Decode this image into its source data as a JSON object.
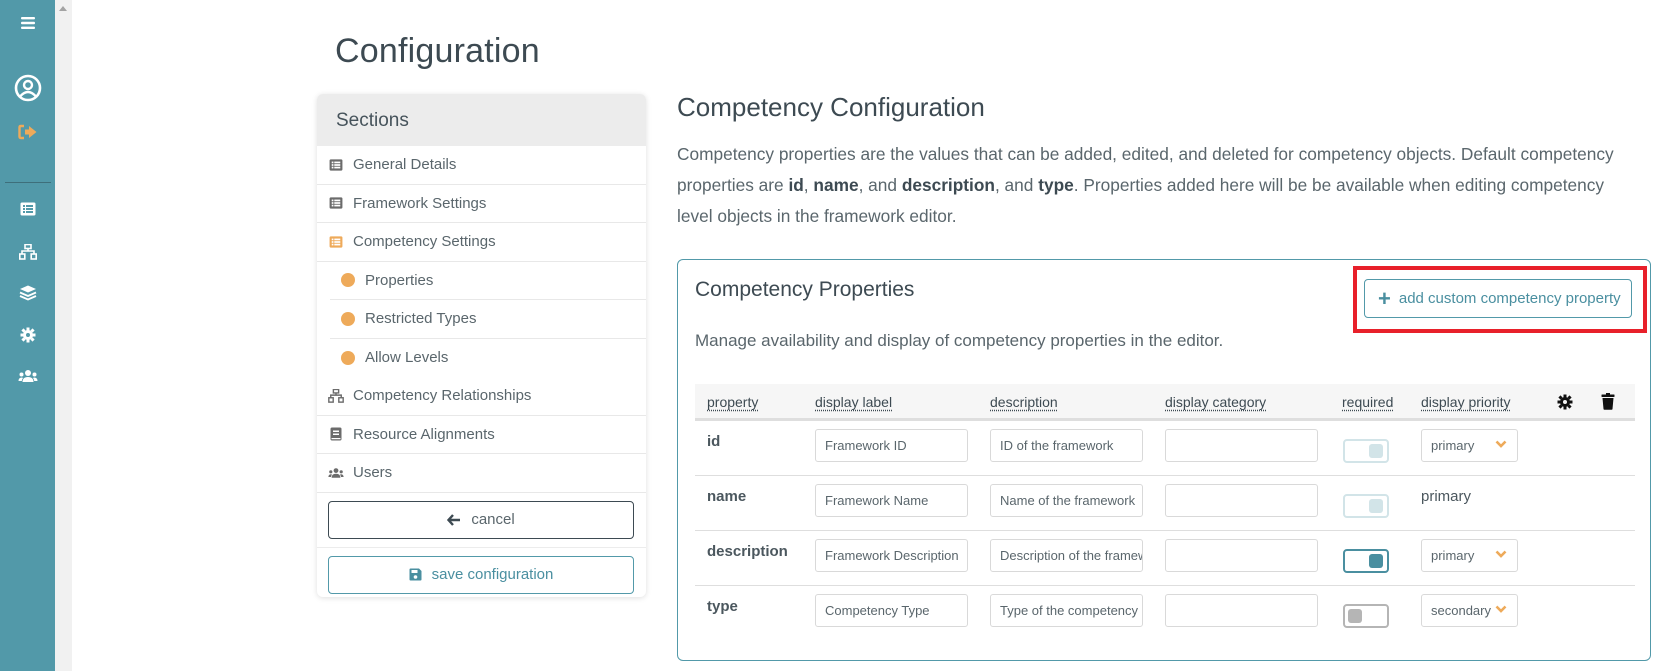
{
  "rail": {
    "icons": [
      "menu-icon",
      "user-circle-icon",
      "sign-out-icon",
      "list-icon",
      "sitemap-icon",
      "layers-icon",
      "gear-icon",
      "users-icon"
    ],
    "colors": {
      "background": "#5299a9",
      "accent": "#eeaa5a"
    }
  },
  "page": {
    "title": "Configuration"
  },
  "sections": {
    "heading": "Sections",
    "items": [
      {
        "label": "General Details",
        "icon": "list-icon",
        "active": false
      },
      {
        "label": "Framework Settings",
        "icon": "list-icon",
        "active": false
      },
      {
        "label": "Competency Settings",
        "icon": "list-icon",
        "active": true
      },
      {
        "label": "Properties",
        "sub": true
      },
      {
        "label": "Restricted Types",
        "sub": true
      },
      {
        "label": "Allow Levels",
        "sub": true
      },
      {
        "label": "Competency Relationships",
        "icon": "sitemap-icon",
        "active": false
      },
      {
        "label": "Resource Alignments",
        "icon": "book-icon",
        "active": false
      },
      {
        "label": "Users",
        "icon": "users-icon",
        "active": false
      }
    ],
    "cancel_label": "cancel",
    "save_label": "save configuration"
  },
  "main": {
    "title": "Competency Configuration",
    "description": {
      "p1": "Competency properties are the values that can be added, edited, and deleted for competency objects. Default competency properties are ",
      "b1": "id",
      "s1": ", ",
      "b2": "name",
      "s2": ", and ",
      "b3": "description",
      "s3": ", and ",
      "b4": "type",
      "p2": ". Properties added here will be be available when editing competency level objects in the framework editor."
    }
  },
  "card": {
    "title": "Competency Properties",
    "add_button_label": "add custom competency property",
    "description": "Manage availability and display of competency properties in the editor.",
    "highlight_color": "#e8202a",
    "columns": [
      "property",
      "display label",
      "description",
      "display category",
      "required",
      "display priority"
    ],
    "header_icons": [
      "gear-icon",
      "trash-icon"
    ],
    "rows": [
      {
        "property": "id",
        "display_label": "Framework ID",
        "description": "ID of the framework",
        "display_category": "",
        "required": "disabled-on",
        "priority": "primary",
        "priority_editable": true
      },
      {
        "property": "name",
        "display_label": "Framework Name",
        "description": "Name of the framework",
        "display_category": "",
        "required": "disabled-on",
        "priority": "primary",
        "priority_editable": false
      },
      {
        "property": "description",
        "display_label": "Framework Description",
        "description": "Description of the framew",
        "display_category": "",
        "required": "on",
        "priority": "primary",
        "priority_editable": true
      },
      {
        "property": "type",
        "display_label": "Competency Type",
        "description": "Type of the competency",
        "display_category": "",
        "required": "off",
        "priority": "secondary",
        "priority_editable": true
      }
    ]
  }
}
